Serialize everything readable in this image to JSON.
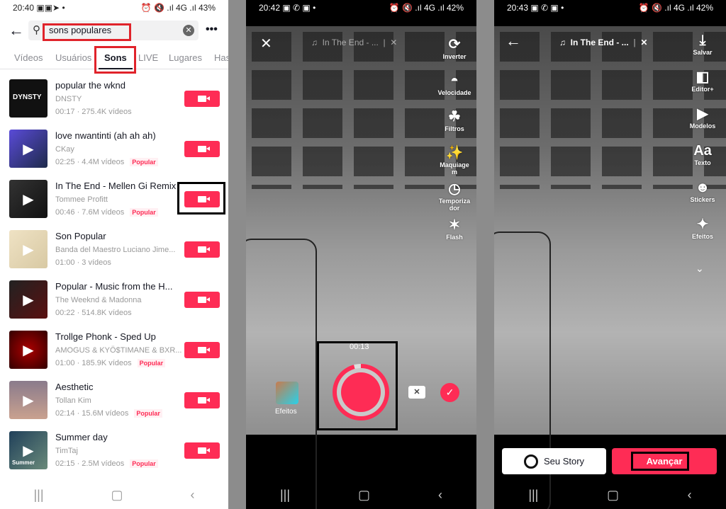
{
  "panel1": {
    "status": {
      "time": "20:40",
      "icons": "▣▣➤ •",
      "right": "⏰ 🔇 .ıl 4G .ıl 43%"
    },
    "search": {
      "value": "sons populares"
    },
    "tabs": [
      {
        "label": "Vídeos"
      },
      {
        "label": "Usuários"
      },
      {
        "label": "Sons",
        "active": true
      },
      {
        "label": "LIVE"
      },
      {
        "label": "Lugares"
      },
      {
        "label": "Has"
      }
    ],
    "sounds": [
      {
        "title": "popular the wknd",
        "artist": "DNSTY",
        "meta": "00:17 · 275.4K vídeos",
        "badge": "",
        "thumb_text": "DYNSTY"
      },
      {
        "title": "love nwantinti (ah ah ah)",
        "artist": "CKay",
        "meta": "02:25 · 4.4M vídeos",
        "badge": "Popular"
      },
      {
        "title": "In The End - Mellen Gi Remix",
        "artist": "Tommee Profitt",
        "meta": "00:46 · 7.6M vídeos",
        "badge": "Popular"
      },
      {
        "title": "Son Popular",
        "artist": "Banda del Maestro Luciano Jime...",
        "meta": "01:00 · 3 vídeos",
        "badge": ""
      },
      {
        "title": "Popular - Music from the H...",
        "artist": "The Weeknd & Madonna",
        "meta": "00:22 · 514.8K vídeos",
        "badge": ""
      },
      {
        "title": "Trollge Phonk - Sped Up",
        "artist": "AMOGUS & KYÖ$TIMANE & BXR...",
        "meta": "01:00 · 185.9K vídeos",
        "badge": "Popular"
      },
      {
        "title": "Aesthetic",
        "artist": "Tollan Kim",
        "meta": "02:14 · 15.6M vídeos",
        "badge": "Popular"
      },
      {
        "title": "Summer day",
        "artist": "TimTaj",
        "meta": "02:15 · 2.5M vídeos",
        "badge": "Popular",
        "thumb_text": "Summer"
      }
    ]
  },
  "panel2": {
    "status": {
      "time": "20:42",
      "icons": "▣ ✆ ▣ •",
      "right": "⏰ 🔇 .ıl 4G .ıl 42%"
    },
    "sound_label": "In The End - ...",
    "tools": [
      {
        "label": "Inverter",
        "icon": "flip-camera-icon"
      },
      {
        "label": "Velocidade",
        "icon": "speed-icon"
      },
      {
        "label": "Filtros",
        "icon": "filters-icon"
      },
      {
        "label": "Maquiagem",
        "icon": "makeup-icon"
      },
      {
        "label": "Temporizador",
        "icon": "timer-icon"
      },
      {
        "label": "Flash",
        "icon": "flash-off-icon"
      }
    ],
    "timer": "00:13",
    "effects_label": "Efeitos"
  },
  "panel3": {
    "status": {
      "time": "20:43",
      "icons": "▣ ✆ ▣ •",
      "right": "⏰ 🔇 .ıl 4G .ıl 42%"
    },
    "sound_label": "In The End - ...",
    "tools": [
      {
        "label": "Salvar",
        "icon": "download-icon"
      },
      {
        "label": "Editor+",
        "icon": "editor-icon"
      },
      {
        "label": "Modelos",
        "icon": "templates-icon"
      },
      {
        "label": "Texto",
        "icon": "text-icon"
      },
      {
        "label": "Stickers",
        "icon": "sticker-icon"
      },
      {
        "label": "Efeitos",
        "icon": "effects-icon"
      }
    ],
    "story_label": "Seu Story",
    "next_label": "Avançar"
  },
  "colors": {
    "accent": "#fe2c55",
    "annotation_red": "#e0232b",
    "annotation_black": "#000000"
  }
}
